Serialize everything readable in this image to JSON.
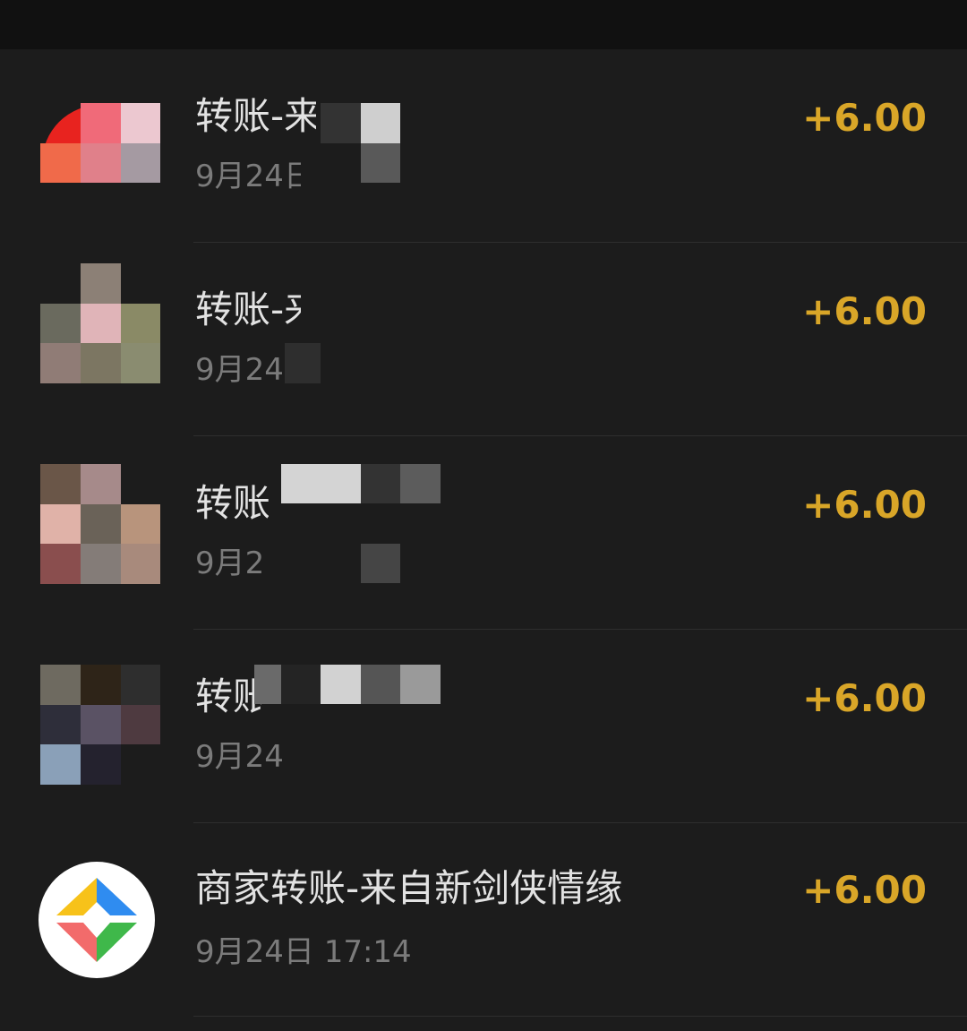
{
  "transactions": [
    {
      "title": "转账-来",
      "time": "9月24日",
      "amount": "+6.00"
    },
    {
      "title": "转账-来",
      "time": "9月24",
      "amount": "+6.00"
    },
    {
      "title": "转账",
      "time": "9月2",
      "amount": "+6.00"
    },
    {
      "title": "转账",
      "time": "9月24",
      "amount": "+6.00"
    },
    {
      "title": "商家转账-来自新剑侠情缘",
      "time": "9月24日 17:14",
      "amount": "+6.00"
    }
  ],
  "colors": {
    "background": "#1c1c1c",
    "amount": "#d9a628",
    "title": "#e2e2e2",
    "time": "#7b7b7b"
  },
  "icons": {
    "merchant": "pinwheel-merchant-logo-icon"
  }
}
